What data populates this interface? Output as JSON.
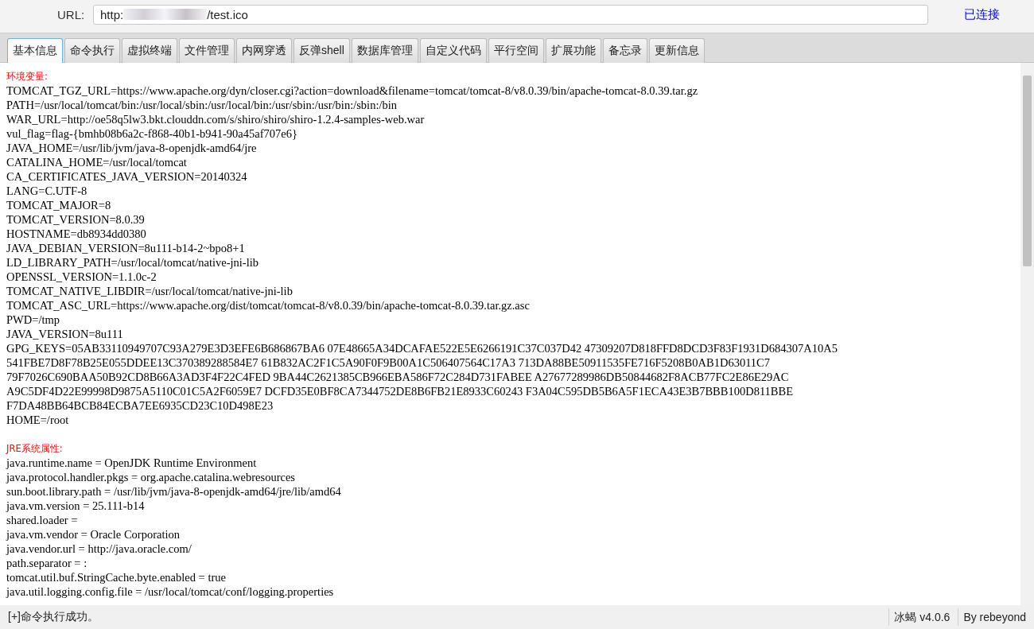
{
  "url_bar": {
    "label": "URL:",
    "value_start": "http:",
    "value_end": "/test.ico",
    "status": "已连接"
  },
  "tabs": [
    {
      "label": "基本信息",
      "selected": true
    },
    {
      "label": "命令执行",
      "selected": false
    },
    {
      "label": "虚拟终端",
      "selected": false
    },
    {
      "label": "文件管理",
      "selected": false
    },
    {
      "label": "内网穿透",
      "selected": false
    },
    {
      "label": "反弹shell",
      "selected": false
    },
    {
      "label": "数据库管理",
      "selected": false
    },
    {
      "label": "自定义代码",
      "selected": false
    },
    {
      "label": "平行空间",
      "selected": false
    },
    {
      "label": "扩展功能",
      "selected": false
    },
    {
      "label": "备忘录",
      "selected": false
    },
    {
      "label": "更新信息",
      "selected": false
    }
  ],
  "sections": [
    {
      "title": "环境变量:",
      "lines": [
        "TOMCAT_TGZ_URL=https://www.apache.org/dyn/closer.cgi?action=download&filename=tomcat/tomcat-8/v8.0.39/bin/apache-tomcat-8.0.39.tar.gz",
        "PATH=/usr/local/tomcat/bin:/usr/local/sbin:/usr/local/bin:/usr/sbin:/usr/bin:/sbin:/bin",
        "WAR_URL=http://oe58q5lw3.bkt.clouddn.com/s/shiro/shiro/shiro-1.2.4-samples-web.war",
        "vul_flag=flag-{bmhb08b6a2c-f868-40b1-b941-90a45af707e6}",
        "JAVA_HOME=/usr/lib/jvm/java-8-openjdk-amd64/jre",
        "CATALINA_HOME=/usr/local/tomcat",
        "CA_CERTIFICATES_JAVA_VERSION=20140324",
        "LANG=C.UTF-8",
        "TOMCAT_MAJOR=8",
        "TOMCAT_VERSION=8.0.39",
        "HOSTNAME=db8934dd0380",
        "JAVA_DEBIAN_VERSION=8u111-b14-2~bpo8+1",
        "LD_LIBRARY_PATH=/usr/local/tomcat/native-jni-lib",
        "OPENSSL_VERSION=1.1.0c-2",
        "TOMCAT_NATIVE_LIBDIR=/usr/local/tomcat/native-jni-lib",
        "TOMCAT_ASC_URL=https://www.apache.org/dist/tomcat/tomcat-8/v8.0.39/bin/apache-tomcat-8.0.39.tar.gz.asc",
        "PWD=/tmp",
        "JAVA_VERSION=8u111",
        "GPG_KEYS=05AB33110949707C93A279E3D3EFE6B686867BA6 07E48665A34DCAFAE522E5E6266191C37C037D42 47309207D818FFD8DCD3F83F1931D684307A10A5",
        "541FBE7D8F78B25E055DDEE13C370389288584E7 61B832AC2F1C5A90F0F9B00A1C506407564C17A3 713DA88BE50911535FE716F5208B0AB1D63011C7",
        "79F7026C690BAA50B92CD8B66A3AD3F4F22C4FED 9BA44C2621385CB966EBA586F72C284D731FABEE A27677289986DB50844682F8ACB77FC2E86E29AC",
        "A9C5DF4D22E99998D9875A5110C01C5A2F6059E7 DCFD35E0BF8CA7344752DE8B6FB21E8933C60243 F3A04C595DB5B6A5F1ECA43E3B7BBB100D811BBE",
        "F7DA48BB64BCB84ECBA7EE6935CD23C10D498E23",
        "HOME=/root"
      ]
    },
    {
      "title": "JRE系统属性:",
      "lines": [
        "java.runtime.name = OpenJDK Runtime Environment",
        "java.protocol.handler.pkgs = org.apache.catalina.webresources",
        "sun.boot.library.path = /usr/lib/jvm/java-8-openjdk-amd64/jre/lib/amd64",
        "java.vm.version = 25.111-b14",
        "shared.loader =",
        "java.vm.vendor = Oracle Corporation",
        "java.vendor.url = http://java.oracle.com/",
        "path.separator = :",
        "tomcat.util.buf.StringCache.byte.enabled = true",
        "java.util.logging.config.file = /usr/local/tomcat/conf/logging.properties"
      ]
    }
  ],
  "status_bar": {
    "message": "[+]命令执行成功。",
    "version": "冰蝎 v4.0.6",
    "author": "By rebeyond"
  }
}
